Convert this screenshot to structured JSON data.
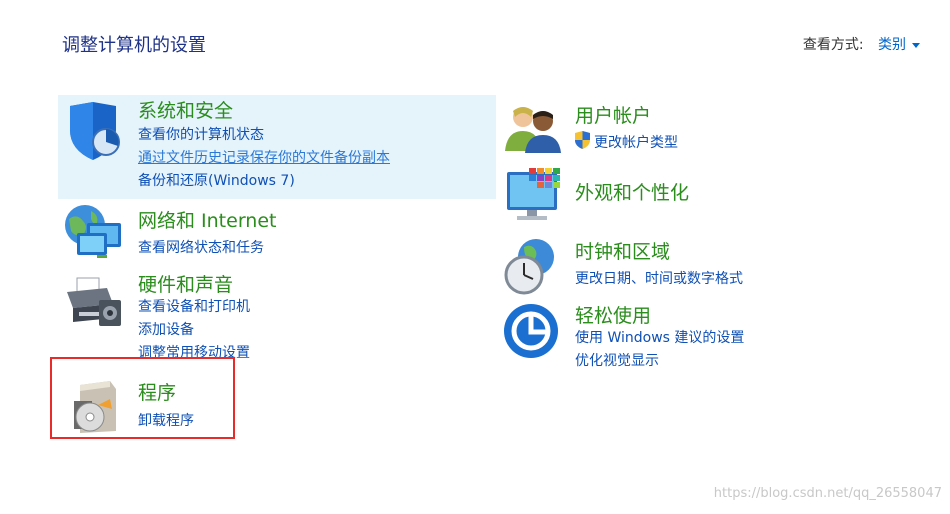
{
  "title": "调整计算机的设置",
  "view_by": {
    "label": "查看方式:",
    "value": "类别"
  },
  "categories_left": [
    {
      "name": "系统和安全",
      "links": [
        "查看你的计算机状态",
        "通过文件历史记录保存你的文件备份副本",
        "备份和还原(Windows 7)"
      ]
    },
    {
      "name": "网络和 Internet",
      "links": [
        "查看网络状态和任务"
      ]
    },
    {
      "name": "硬件和声音",
      "links": [
        "查看设备和打印机",
        "添加设备",
        "调整常用移动设置"
      ]
    },
    {
      "name": "程序",
      "links": [
        "卸载程序"
      ]
    }
  ],
  "categories_right": [
    {
      "name": "用户帐户",
      "links": [
        "更改帐户类型"
      ]
    },
    {
      "name": "外观和个性化",
      "links": []
    },
    {
      "name": "时钟和区域",
      "links": [
        "更改日期、时间或数字格式"
      ]
    },
    {
      "name": "轻松使用",
      "links": [
        "使用 Windows 建议的设置",
        "优化视觉显示"
      ]
    }
  ],
  "watermark": "https://blog.csdn.net/qq_26558047"
}
